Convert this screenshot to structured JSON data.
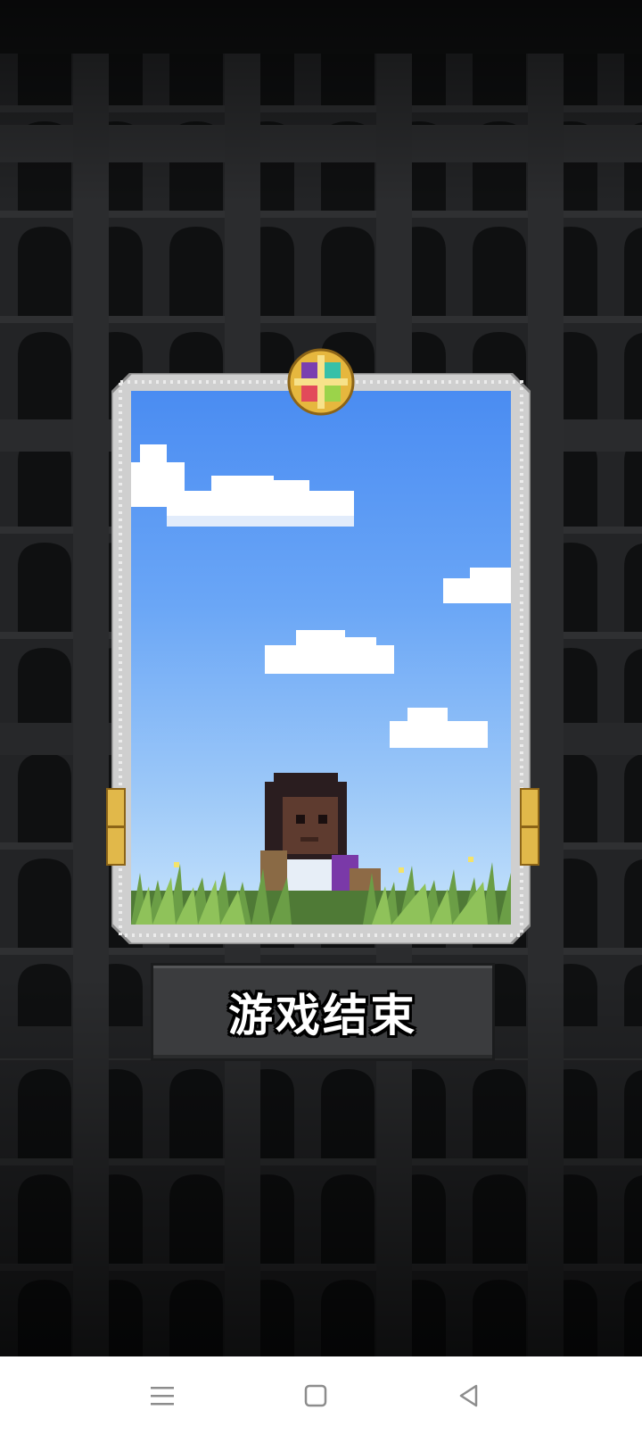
{
  "game": {
    "result_title": "游戏结束",
    "card": {
      "character": "pixel-warrior-character",
      "emblem": "four-gem-emblem-icon",
      "scene": "sky-with-clouds-and-grass"
    }
  },
  "navbar": {
    "menu_icon": "menu-icon",
    "home_icon": "home-square-icon",
    "back_icon": "back-triangle-icon"
  },
  "colors": {
    "background": "#1f2022",
    "sky_top": "#4a8cf2",
    "sky_bottom": "#c6e3fb",
    "frame": "#d9d9d9",
    "gold": "#e1b84a",
    "panel": "#3b3c3e",
    "nav_icon": "#8d8d8d"
  }
}
